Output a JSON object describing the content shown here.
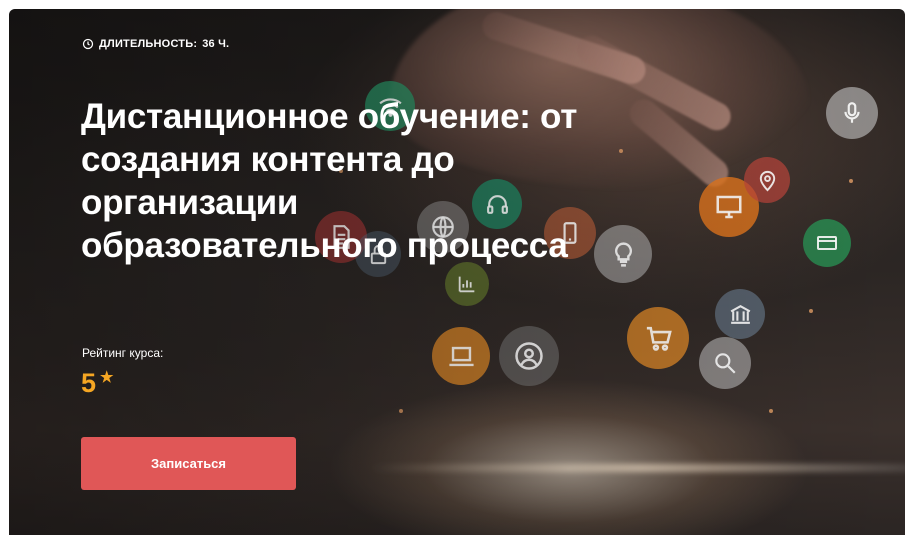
{
  "hero": {
    "duration_label": "ДЛИТЕЛЬНОСТЬ:",
    "duration_value": "36 Ч.",
    "title_lines": [
      "Дистанционное обучение: от",
      "создания контента до",
      "организации",
      "образовательного процесса"
    ],
    "rating_label": "Рейтинг курса:",
    "rating_value": "5",
    "enroll_button": "Записаться"
  },
  "colors": {
    "accent_button": "#e05757",
    "rating": "#f5a623",
    "text": "#ffffff"
  },
  "icons": [
    "clock-icon",
    "star-icon",
    "wifi-icon",
    "document-icon",
    "lock-icon",
    "globe-icon",
    "headset-icon",
    "smartphone-icon",
    "lightbulb-icon",
    "monitor-icon",
    "location-pin-icon",
    "microphone-icon",
    "credit-card-icon",
    "laptop-icon",
    "user-icon",
    "shopping-cart-icon",
    "bank-icon",
    "magnifier-icon"
  ]
}
